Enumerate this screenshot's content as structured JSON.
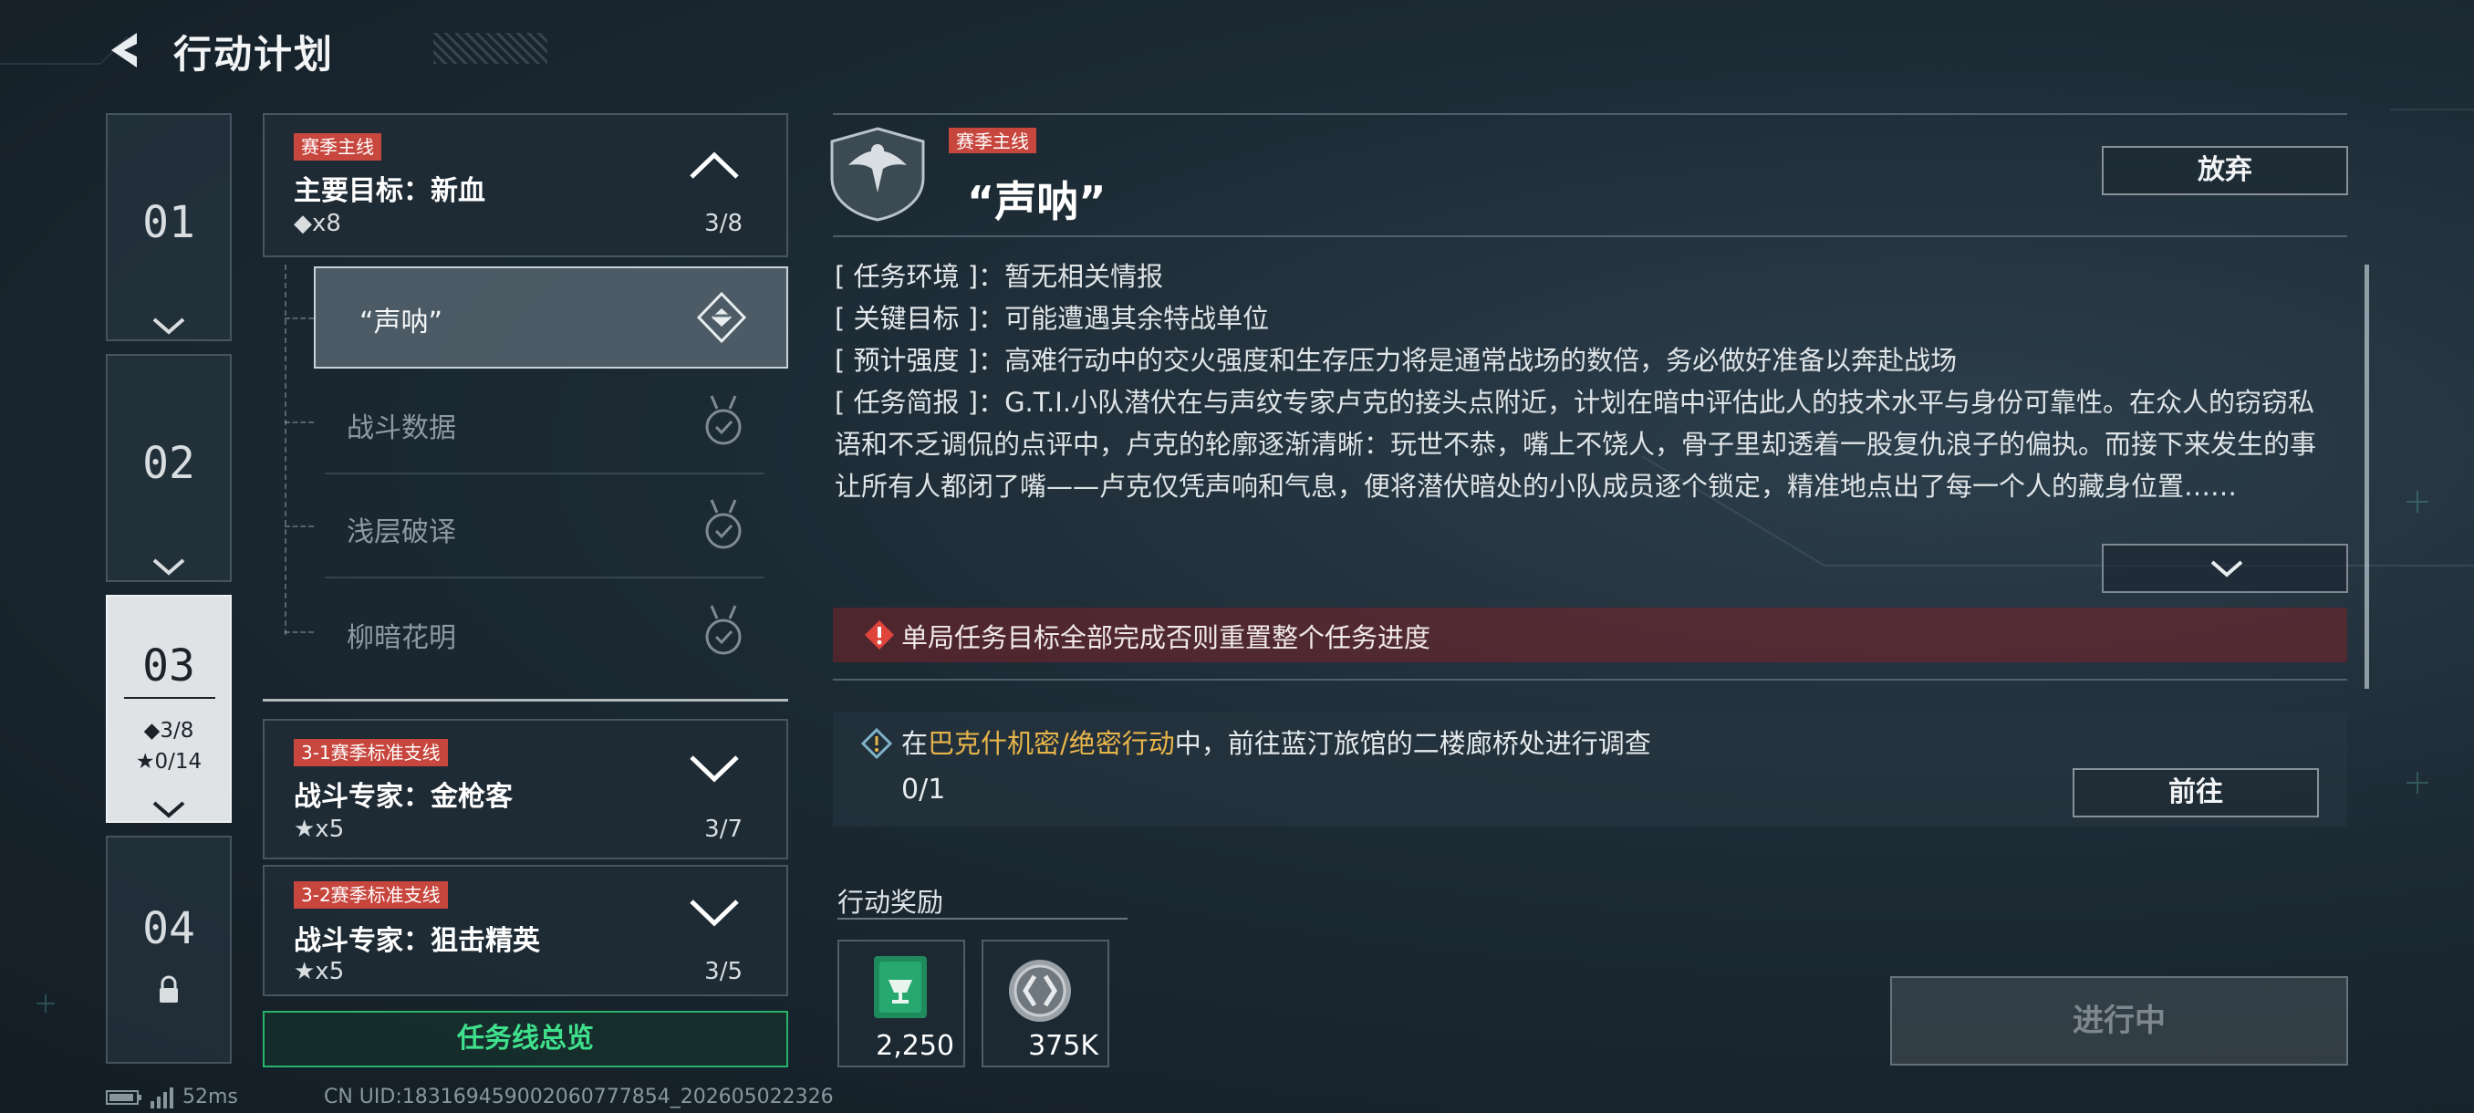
{
  "header": {
    "title": "行动计划"
  },
  "chapters": [
    {
      "num": "01",
      "state": "collapsed"
    },
    {
      "num": "02",
      "state": "collapsed"
    },
    {
      "num": "03",
      "state": "selected",
      "diamond": "◆3/8",
      "star": "★0/14"
    },
    {
      "num": "04",
      "state": "locked"
    }
  ],
  "main_quest": {
    "tag": "赛季主线",
    "title": "主要目标：新血",
    "reward": "◆x8",
    "progress": "3/8",
    "subquests": [
      {
        "label": "“声呐”",
        "state": "active",
        "icon": "active-target-icon"
      },
      {
        "label": "战斗数据",
        "state": "locked",
        "icon": "medal-check-icon"
      },
      {
        "label": "浅层破译",
        "state": "locked",
        "icon": "medal-check-icon"
      },
      {
        "label": "柳暗花明",
        "state": "locked",
        "icon": "medal-check-icon"
      }
    ]
  },
  "side_quests": [
    {
      "tag": "3-1赛季标准支线",
      "title": "战斗专家：金枪客",
      "reward": "★x5",
      "progress": "3/7"
    },
    {
      "tag": "3-2赛季标准支线",
      "title": "战斗专家：狙击精英",
      "reward": "★x5",
      "progress": "3/5"
    }
  ],
  "overview_button": "任务线总览",
  "detail": {
    "tag": "赛季主线",
    "title": "“声呐”",
    "abandon_button": "放弃",
    "environment_key": "[ 任务环境 ]",
    "environment": "：暂无相关情报",
    "key_target_key": "[ 关键目标 ]",
    "key_target": "：可能遭遇其余特战单位",
    "intensity_key": "[ 预计强度 ]",
    "intensity": "：高难行动中的交火强度和生存压力将是通常战场的数倍，务必做好准备以奔赴战场",
    "brief_key": "[ 任务简报 ]",
    "brief": "：G.T.I.小队潜伏在与声纹专家卢克的接头点附近，计划在暗中评估此人的技术水平与身份可靠性。在众人的窃窃私语和不乏调侃的点评中，卢克的轮廓逐渐清晰：玩世不恭，嘴上不饶人，骨子里却透着一股复仇浪子的偏执。而接下来发生的事让所有人都闭了嘴——卢克仅凭声响和气息，便将潜伏暗处的小队成员逐个锁定，精准地点出了每一个人的藏身位置……",
    "warning": "单局任务目标全部完成否则重置整个任务进度",
    "task": {
      "prefix": "在",
      "highlight": "巴克什机密/绝密行动",
      "suffix": "中，前往蓝汀旅馆的二楼廊桥处进行调查",
      "progress": "0/1",
      "goto_button": "前往"
    },
    "rewards_label": "行动奖励",
    "rewards": [
      {
        "amount": "2,250",
        "icon": "green-crate-icon"
      },
      {
        "amount": "375K",
        "icon": "silver-coin-icon"
      }
    ],
    "status_button": "进行中"
  },
  "status_bar": {
    "ping": "52ms",
    "uid": "CN UID:1831694590020607778​54_202605022326"
  },
  "colors": {
    "accent_green": "#3fe08c",
    "tag_red": "#c7463d",
    "highlight_gold": "#e8b54a",
    "warning_bg": "#78232a"
  }
}
